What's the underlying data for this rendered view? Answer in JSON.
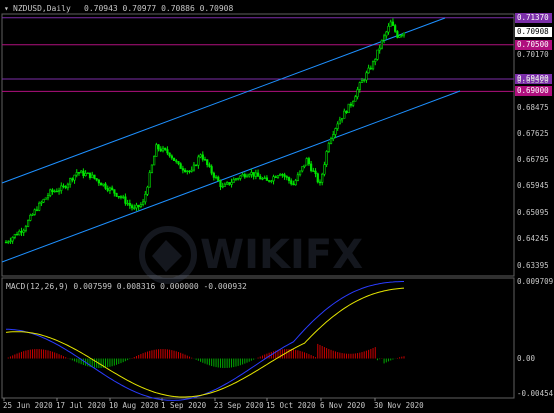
{
  "header": {
    "symbol": "NZDUSD,Daily",
    "ohlc": "0.70943 0.70977 0.70886 0.70908"
  },
  "macd": {
    "label": "MACD(12,26,9) 0.007599 0.008316 0.000000 -0.000932"
  },
  "watermark": "WIKIFX",
  "price_axis": {
    "ticks": [
      "0.70908",
      "0.70170",
      "0.69320",
      "0.68475",
      "0.67625",
      "0.66795",
      "0.65945",
      "0.65095",
      "0.64245",
      "0.63395"
    ],
    "tags": [
      {
        "label": "0.71370",
        "value": 0.7137,
        "color": "#7b2ea8"
      },
      {
        "label": "0.70500",
        "value": 0.705,
        "color": "#b0107e"
      },
      {
        "label": "0.69400",
        "value": 0.694,
        "color": "#7b2ea8"
      },
      {
        "label": "0.69000",
        "value": 0.69,
        "color": "#b0107e"
      }
    ],
    "last_label": "0.70908"
  },
  "macd_axis": {
    "ticks": [
      "0.009709",
      "0.00",
      "-0.004541"
    ]
  },
  "dates": [
    "25 Jun 2020",
    "17 Jul 2020",
    "10 Aug 2020",
    "1 Sep 2020",
    "23 Sep 2020",
    "15 Oct 2020",
    "6 Nov 2020",
    "30 Nov 2020"
  ],
  "colors": {
    "bull": "#00e600",
    "channel": "#1e90ff",
    "macd_main": "#2a3cff",
    "macd_signal": "#e6e600",
    "hist_pos": "#cc0000",
    "hist_neg": "#00aa00",
    "level_purple": "#7b2ea8",
    "level_magenta": "#b0107e"
  }
}
